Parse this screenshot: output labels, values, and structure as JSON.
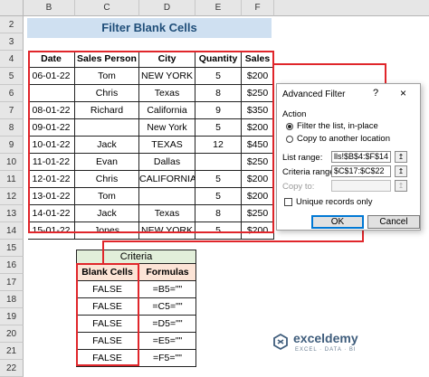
{
  "columns": [
    "B",
    "C",
    "D",
    "E",
    "F"
  ],
  "rows": [
    "2",
    "3",
    "4",
    "5",
    "6",
    "7",
    "8",
    "9",
    "10",
    "11",
    "12",
    "13",
    "14",
    "15",
    "16",
    "17",
    "18",
    "19",
    "20",
    "21",
    "22"
  ],
  "sheet_title": "Filter Blank Cells",
  "table": {
    "headers": [
      "Date",
      "Sales Person",
      "City",
      "Quantity",
      "Sales"
    ],
    "rows": [
      [
        "06-01-22",
        "Tom",
        "NEW YORK",
        "5",
        "$200"
      ],
      [
        "",
        "Chris",
        "Texas",
        "8",
        "$250"
      ],
      [
        "08-01-22",
        "Richard",
        "California",
        "9",
        "$350"
      ],
      [
        "09-01-22",
        "",
        "New York",
        "5",
        "$200"
      ],
      [
        "10-01-22",
        "Jack",
        "TEXAS",
        "12",
        "$450"
      ],
      [
        "11-01-22",
        "Evan",
        "Dallas",
        "",
        "$250"
      ],
      [
        "12-01-22",
        "Chris",
        "CALIFORNIA",
        "5",
        "$200"
      ],
      [
        "13-01-22",
        "Tom",
        "",
        "5",
        "$200"
      ],
      [
        "14-01-22",
        "Jack",
        "Texas",
        "8",
        "$250"
      ],
      [
        "15-01-22",
        "Jones",
        "NEW YORK",
        "5",
        "$200"
      ]
    ]
  },
  "criteria": {
    "caption": "Criteria",
    "headers": [
      "Blank Cells",
      "Formulas"
    ],
    "rows": [
      [
        "FALSE",
        "=B5=\"\""
      ],
      [
        "FALSE",
        "=C5=\"\""
      ],
      [
        "FALSE",
        "=D5=\"\""
      ],
      [
        "FALSE",
        "=E5=\"\""
      ],
      [
        "FALSE",
        "=F5=\"\""
      ]
    ]
  },
  "dialog": {
    "title": "Advanced Filter",
    "help": "?",
    "close": "×",
    "action_label": "Action",
    "option_inplace": "Filter the list, in-place",
    "option_copy": "Copy to another location",
    "list_range_label": "List range:",
    "list_range_value": "lls!$B$4:$F$14",
    "criteria_range_label": "Criteria range:",
    "criteria_range_value": "$C$17:$C$22",
    "copy_to_label": "Copy to:",
    "copy_to_value": "",
    "unique_label": "Unique records only",
    "ok": "OK",
    "cancel": "Cancel",
    "collapse_icon": "↥"
  },
  "watermark": {
    "name": "exceldemy",
    "tagline": "EXCEL · DATA · BI"
  },
  "colors": {
    "highlight_red": "#e0262b",
    "title_fill": "#cfe0f1",
    "criteria_fill": "#e2efda"
  }
}
